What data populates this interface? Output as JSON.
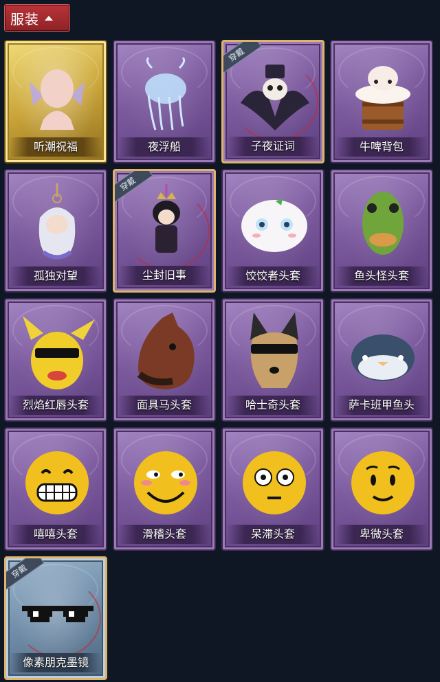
{
  "section": {
    "title": "服装"
  },
  "badge_text": "穿戴",
  "items": [
    {
      "name": "听潮祝福",
      "rarity": "gold",
      "equipped": false,
      "icon": "mermaid-head-icon"
    },
    {
      "name": "夜浮船",
      "rarity": "purple",
      "equipped": false,
      "icon": "jellyfish-pendant-icon"
    },
    {
      "name": "子夜证词",
      "rarity": "purple",
      "equipped": true,
      "icon": "raven-plague-doctor-icon"
    },
    {
      "name": "牛啤背包",
      "rarity": "purple",
      "equipped": false,
      "icon": "cow-beer-barrel-icon"
    },
    {
      "name": "孤独对望",
      "rarity": "purple",
      "equipped": false,
      "icon": "doll-pendant-icon"
    },
    {
      "name": "尘封旧事",
      "rarity": "purple",
      "equipped": true,
      "icon": "crowned-doll-pendant-icon"
    },
    {
      "name": "饺饺者头套",
      "rarity": "purple",
      "equipped": false,
      "icon": "dumpling-mask-icon"
    },
    {
      "name": "鱼头怪头套",
      "rarity": "purple",
      "equipped": false,
      "icon": "fish-head-mask-icon"
    },
    {
      "name": "烈焰红唇头套",
      "rarity": "purple",
      "equipped": false,
      "icon": "yellow-mouse-mask-icon"
    },
    {
      "name": "面具马头套",
      "rarity": "purple",
      "equipped": false,
      "icon": "horse-mask-icon"
    },
    {
      "name": "哈士奇头套",
      "rarity": "purple",
      "equipped": false,
      "icon": "husky-mask-icon"
    },
    {
      "name": "萨卡班甲鱼头",
      "rarity": "purple",
      "equipped": false,
      "icon": "fish-blob-mask-icon"
    },
    {
      "name": "嘻嘻头套",
      "rarity": "purple",
      "equipped": false,
      "icon": "grinning-emoji-mask-icon"
    },
    {
      "name": "滑稽头套",
      "rarity": "purple",
      "equipped": false,
      "icon": "smirk-emoji-mask-icon"
    },
    {
      "name": "呆滞头套",
      "rarity": "purple",
      "equipped": false,
      "icon": "flushed-emoji-mask-icon"
    },
    {
      "name": "卑微头套",
      "rarity": "purple",
      "equipped": false,
      "icon": "pleading-emoji-mask-icon"
    },
    {
      "name": "像素朋克墨镜",
      "rarity": "blue",
      "equipped": true,
      "icon": "pixel-sunglasses-icon"
    }
  ]
}
